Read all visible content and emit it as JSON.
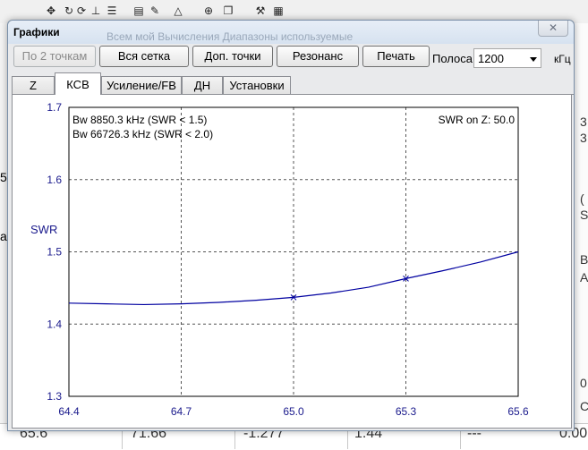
{
  "background": {
    "right_fragments": [
      "3",
      "3.",
      "(",
      "S",
      "B",
      "A",
      "0",
      "C"
    ],
    "left_fragments": [
      "5",
      "a"
    ],
    "bottom_row": [
      "65.6",
      "71.66",
      "-1.277",
      "1.44",
      "---",
      "0.00"
    ]
  },
  "dialog": {
    "title": "Графики",
    "ghost_text": "Всем мой     Вычисления     Диапазоны используемые",
    "close_symbol": "✕",
    "buttons": {
      "two_points": "По 2 точкам",
      "all_grid": "Вся сетка",
      "extra_points": "Доп. точки",
      "resonance": "Резонанс",
      "print": "Печать"
    },
    "band_label": "Полоса",
    "band_value": "1200",
    "band_unit": "кГц",
    "tabs": [
      "Z",
      "КСВ",
      "Усиление/FB",
      "ДН",
      "Установки"
    ],
    "active_tab": "КСВ"
  },
  "chart_data": {
    "type": "line",
    "ylabel": "SWR",
    "xlabel": "",
    "xlim": [
      64.4,
      65.6
    ],
    "ylim": [
      1.3,
      1.7
    ],
    "x_ticks": [
      "64.4",
      "64.7",
      "65.0",
      "65.3",
      "65.6"
    ],
    "y_ticks": [
      "1.3",
      "1.4",
      "1.5",
      "1.6",
      "1.7"
    ],
    "grid": true,
    "annotations": [
      "Bw 8850.3 kHz (SWR < 1.5)",
      "Bw 66726.3 kHz (SWR < 2.0)",
      "SWR on Z: 50.0"
    ],
    "series": [
      {
        "x": [
          64.4,
          64.5,
          64.6,
          64.7,
          64.8,
          64.9,
          65.0,
          65.1,
          65.2,
          65.3,
          65.4,
          65.5,
          65.6
        ],
        "y": [
          1.429,
          1.428,
          1.427,
          1.428,
          1.43,
          1.433,
          1.437,
          1.443,
          1.451,
          1.463,
          1.474,
          1.486,
          1.5
        ],
        "markers_at": [
          65.0,
          65.3
        ],
        "color": "#0000a0"
      }
    ]
  }
}
